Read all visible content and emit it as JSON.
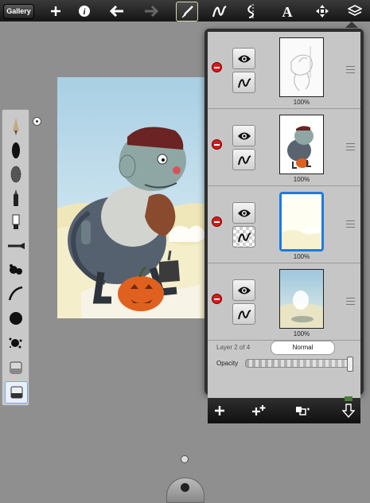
{
  "toolbar": {
    "gallery_label": "Gallery",
    "icons": [
      "add-icon",
      "info-icon",
      "undo-icon",
      "redo-icon",
      "brush-icon",
      "stroke-icon",
      "symmetry-icon",
      "text-icon",
      "transform-icon",
      "layers-icon"
    ],
    "selected": "brush-icon"
  },
  "palette": {
    "tools": [
      "pencil-icon",
      "airbrush-icon",
      "hard-airbrush-icon",
      "marker-icon",
      "paint-tube-icon",
      "ballpoint-icon",
      "splatter-icon",
      "calligraphy-icon",
      "paintbrush-icon",
      "speckle-brush-icon",
      "eraser-icon",
      "smudge-icon"
    ],
    "selected": "smudge-icon"
  },
  "layers": {
    "rows": [
      {
        "opacity_label": "100%",
        "blend_icon": "normal-blend-icon",
        "selected": false,
        "thumb": "sketch"
      },
      {
        "opacity_label": "100%",
        "blend_icon": "normal-blend-icon",
        "selected": false,
        "thumb": "character"
      },
      {
        "opacity_label": "100%",
        "blend_icon": "transparency-icon",
        "selected": true,
        "thumb": "yellow"
      },
      {
        "opacity_label": "100%",
        "blend_icon": "normal-blend-icon",
        "selected": false,
        "thumb": "background"
      }
    ],
    "info": "Layer 2 of 4",
    "blend_mode": "Normal",
    "opacity_label": "Opacity",
    "opacity_value": 0.98,
    "bottom_icons": [
      "add-layer-icon",
      "duplicate-layer-icon",
      "merge-layer-icon",
      "merge-down-icon"
    ]
  },
  "colors": {
    "selection_blue": "#1e7ae0",
    "delete_red": "#d41c1c"
  }
}
